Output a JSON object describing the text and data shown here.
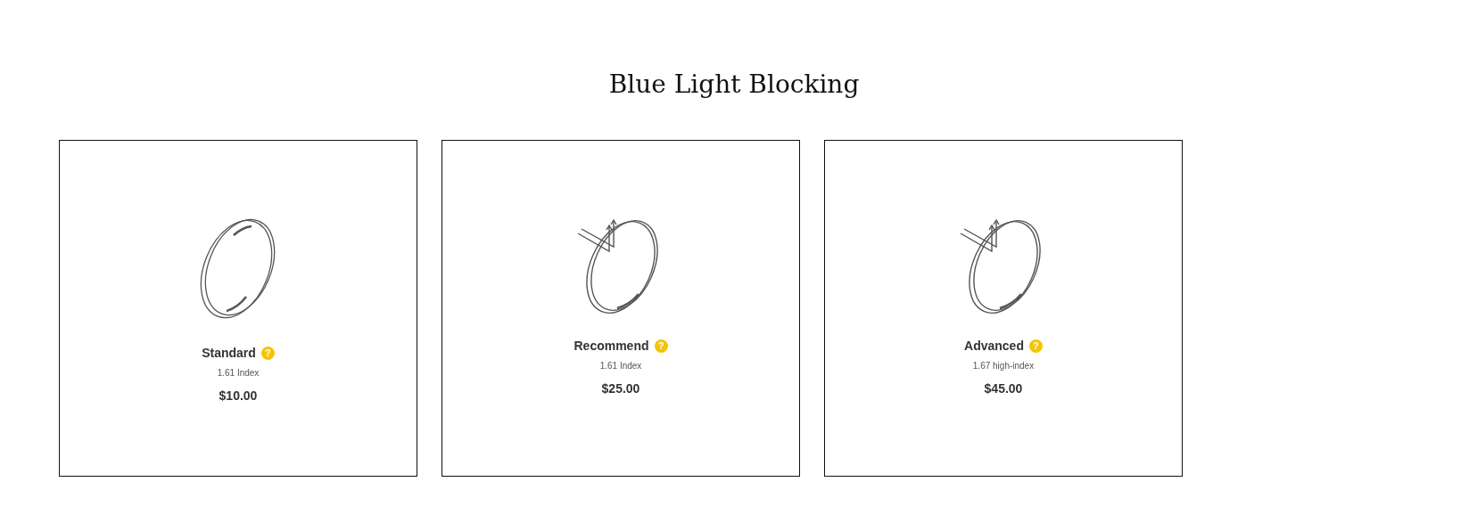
{
  "title": "Blue Light Blocking",
  "options": [
    {
      "kind": "plain",
      "name": "Standard",
      "help": "?",
      "detail": "1.61 Index",
      "price": "$10.00"
    },
    {
      "kind": "blocking",
      "name": "Recommend",
      "help": "?",
      "detail": "1.61 Index",
      "price": "$25.00"
    },
    {
      "kind": "blocking",
      "name": "Advanced",
      "help": "?",
      "detail": "1.67 high-index",
      "price": "$45.00"
    }
  ]
}
